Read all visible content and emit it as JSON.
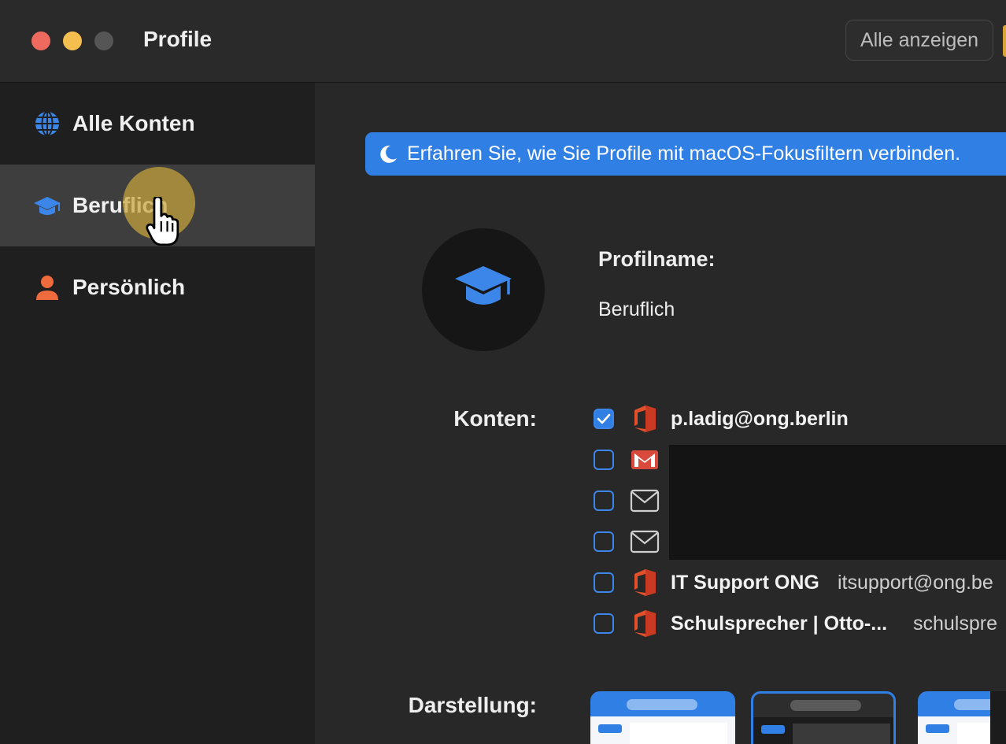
{
  "window": {
    "title": "Profile",
    "show_all_button": "Alle anzeigen"
  },
  "sidebar": {
    "items": [
      {
        "label": "Alle Konten",
        "icon": "globe-icon",
        "color": "#3b86e8",
        "selected": false
      },
      {
        "label": "Beruflich",
        "icon": "graduation-cap-icon",
        "color": "#3b86e8",
        "selected": true
      },
      {
        "label": "Persönlich",
        "icon": "person-icon",
        "color": "#ef6a3c",
        "selected": false
      }
    ]
  },
  "banner": {
    "icon": "moon-icon",
    "text": "Erfahren Sie, wie Sie Profile mit macOS-Fokusfiltern verbinden."
  },
  "profile": {
    "avatar_icon": "graduation-cap-icon",
    "name_label": "Profilname:",
    "name_value": "Beruflich"
  },
  "accounts": {
    "label": "Konten:",
    "items": [
      {
        "checked": true,
        "icon": "office-icon",
        "name": "p.ladig@ong.berlin",
        "email": ""
      },
      {
        "checked": false,
        "icon": "gmail-icon",
        "name": "",
        "email": ""
      },
      {
        "checked": false,
        "icon": "mail-envelope-icon",
        "name": "",
        "email": ""
      },
      {
        "checked": false,
        "icon": "mail-envelope-icon",
        "name": "",
        "email": ""
      },
      {
        "checked": false,
        "icon": "office-icon",
        "name": "IT Support ONG",
        "email": "itsupport@ong.be"
      },
      {
        "checked": false,
        "icon": "office-icon",
        "name": "Schulsprecher | Otto-...",
        "email": "schulspre"
      }
    ]
  },
  "appearance": {
    "label": "Darstellung:",
    "options": [
      "light",
      "dark",
      "auto"
    ],
    "selected": "dark"
  },
  "colors": {
    "accent": "#2f7fe4",
    "sidebar_bg": "#1f1f1f",
    "content_bg": "#282828",
    "selected_bg": "#3e3e3e"
  }
}
